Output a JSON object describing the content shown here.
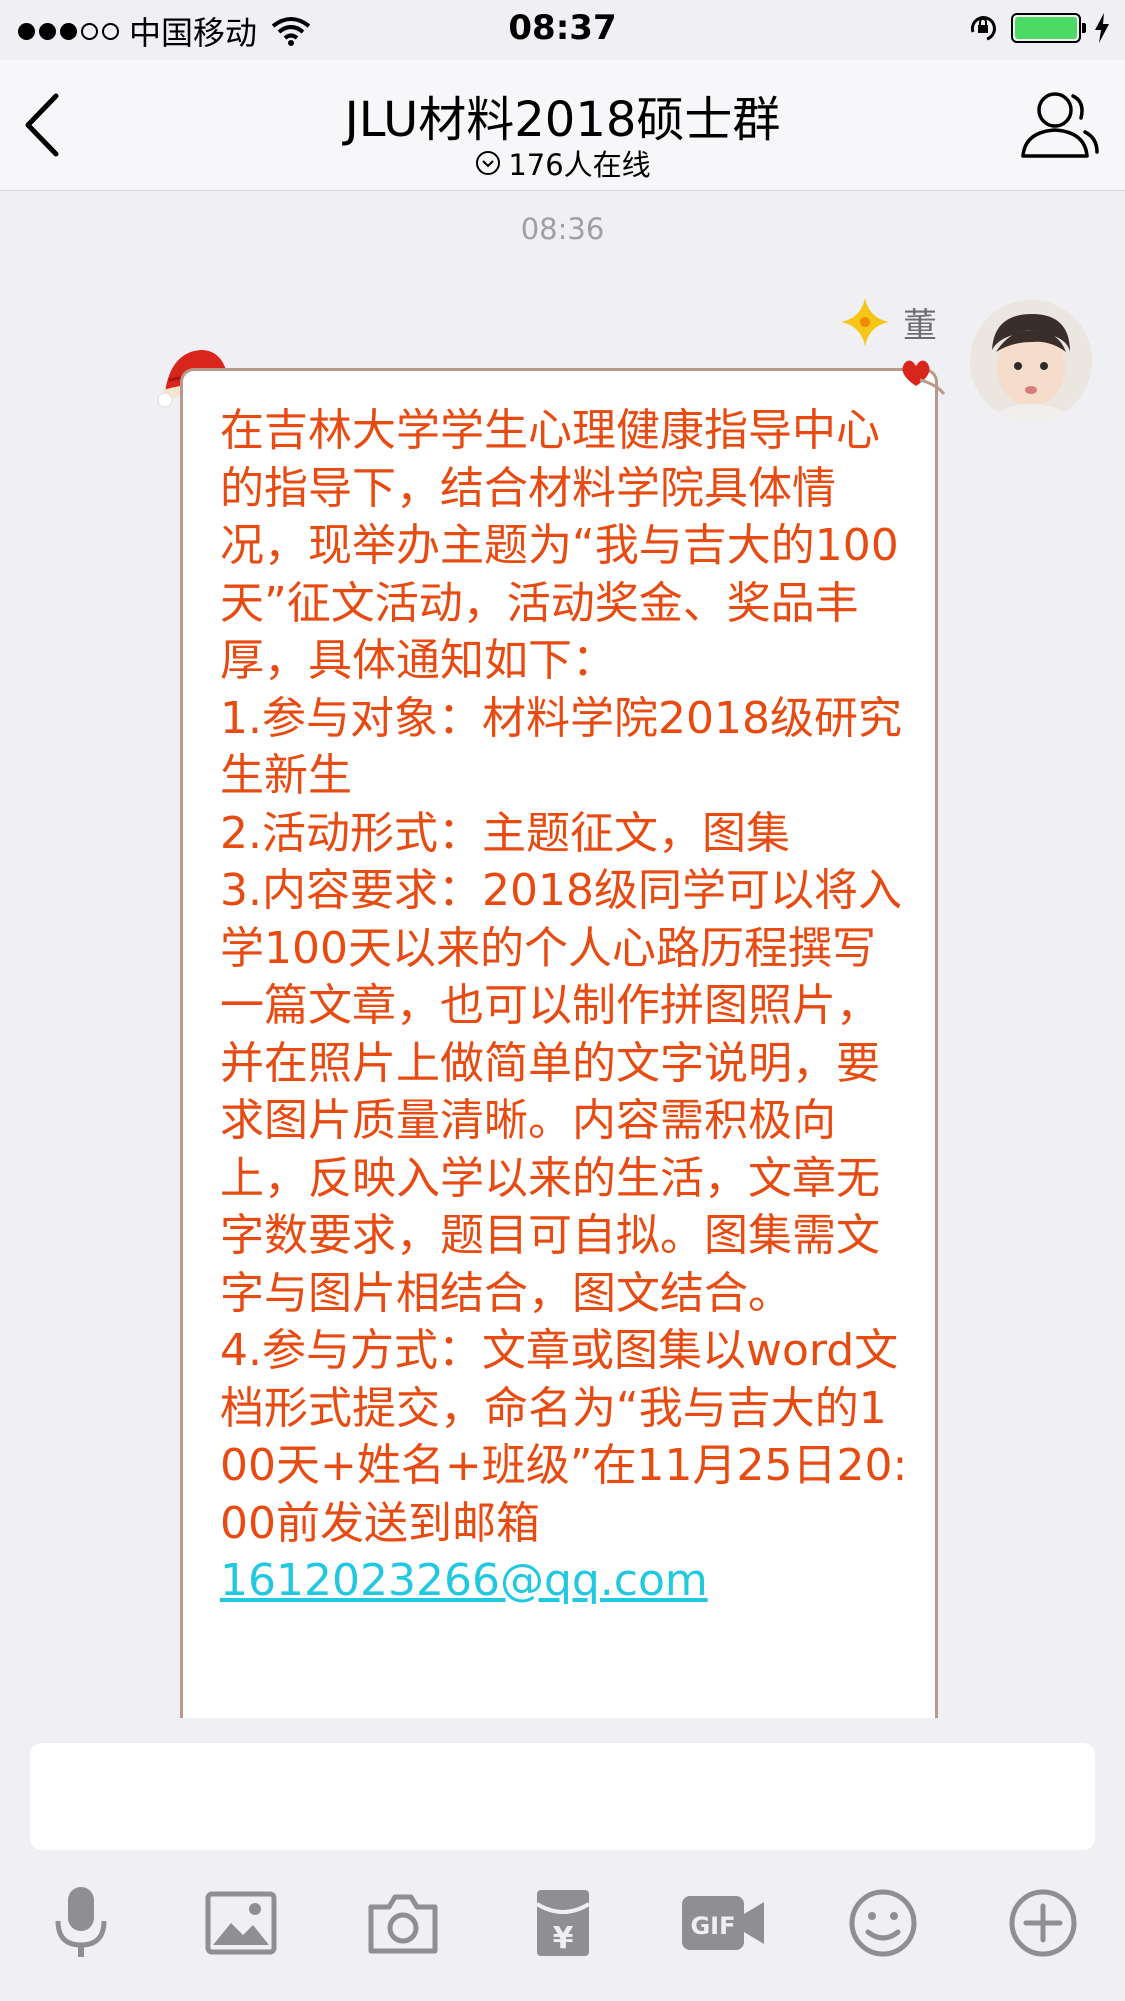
{
  "status_bar": {
    "carrier": "中国移动",
    "time": "08:37"
  },
  "nav": {
    "title": "JLU材料2018硕士群",
    "online": "176人在线"
  },
  "chat": {
    "timestamp": "08:36",
    "sender_name": "董",
    "message_body": "在吉林大学学生心理健康指导中心的指导下，结合材料学院具体情况，现举办主题为“我与吉大的100天”征文活动，活动奖金、奖品丰厚，具体通知如下：\n1.参与对象：材料学院2018级研究生新生\n2.活动形式：主题征文，图集\n3.内容要求：2018级同学可以将入学100天以来的个人心路历程撰写一篇文章，也可以制作拼图照片，并在照片上做简单的文字说明，要求图片质量清晰。内容需积极向上，反映入学以来的生活，文章无字数要求，题目可自拟。图集需文字与图片相结合，图文结合。\n4.参与方式：文章或图集以word文档形式提交，命名为“我与吉大的100天+姓名+班级”在11月25日20:00前发送到邮箱\n",
    "message_email": "1612023266@qq.com"
  },
  "toolbar": {
    "gif_label": "GIF"
  },
  "colors": {
    "message_text": "#e74b12",
    "email_link": "#22c8e0",
    "battery": "#4cd964"
  },
  "icons": [
    "back-arrow-icon",
    "group-profile-icon",
    "microphone-icon",
    "image-icon",
    "camera-icon",
    "red-packet-icon",
    "gif-icon",
    "emoji-icon",
    "plus-icon"
  ]
}
